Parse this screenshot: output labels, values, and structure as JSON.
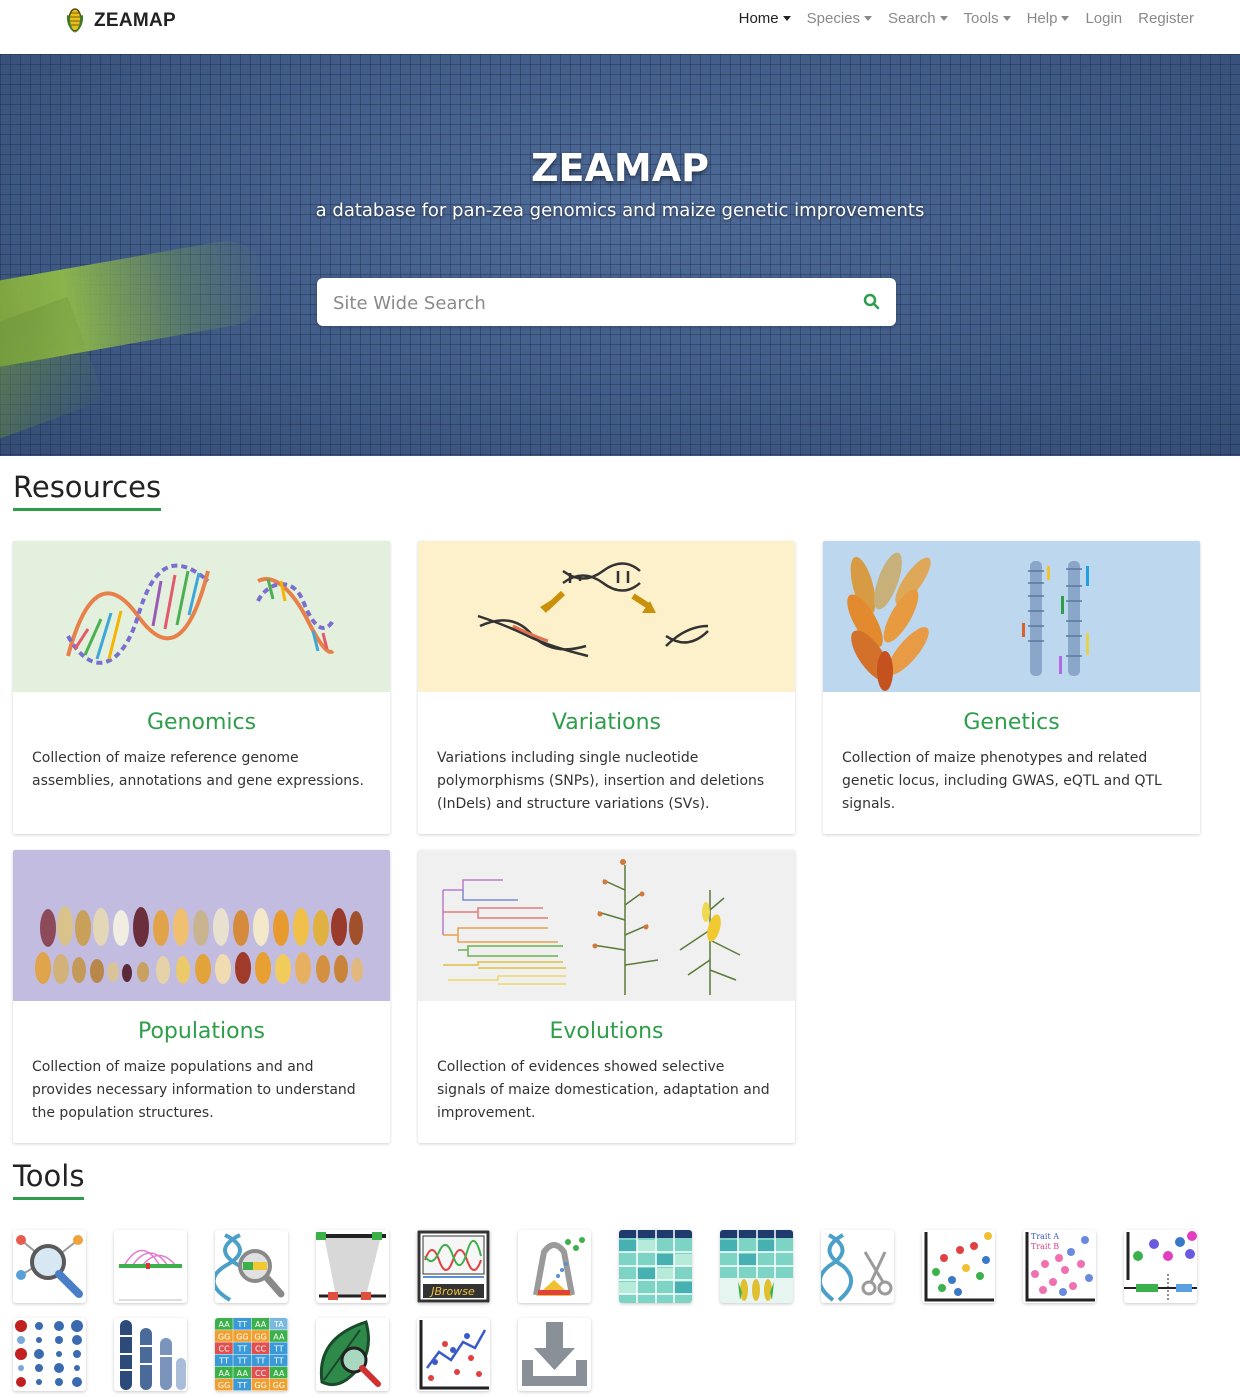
{
  "brand": {
    "name": "ZEAMAP"
  },
  "nav": {
    "items": [
      {
        "label": "Home",
        "dropdown": true,
        "active": true
      },
      {
        "label": "Species",
        "dropdown": true
      },
      {
        "label": "Search",
        "dropdown": true
      },
      {
        "label": "Tools",
        "dropdown": true
      },
      {
        "label": "Help",
        "dropdown": true
      },
      {
        "label": "Login",
        "dropdown": false
      },
      {
        "label": "Register",
        "dropdown": false
      }
    ]
  },
  "hero": {
    "title": "ZEAMAP",
    "subtitle": "a database for pan-zea genomics and maize genetic improvements",
    "search_placeholder": "Site Wide Search"
  },
  "resources": {
    "heading": "Resources",
    "cards": [
      {
        "title": "Genomics",
        "description": "Collection of maize reference genome assemblies, annotations and gene expressions.",
        "bg": "#e3f0dd"
      },
      {
        "title": "Variations",
        "description": "Variations including single nucleotide polymorphisms (SNPs), insertion and deletions (InDels) and structure variations (SVs).",
        "bg": "#fdf1cc"
      },
      {
        "title": "Genetics",
        "description": "Collection of maize phenotypes and related genetic locus, including GWAS, eQTL and QTL signals.",
        "bg": "#bcd7ee"
      },
      {
        "title": "Populations",
        "description": "Collection of maize populations and and provides necessary information to understand the population structures.",
        "bg": "#c2bde0"
      },
      {
        "title": "Evolutions",
        "description": "Collection of evidences showed selective signals of maize domestication, adaptation and improvement.",
        "bg": "#f0f0f0"
      }
    ]
  },
  "tools": {
    "heading": "Tools",
    "items": [
      {
        "icon": "network-search-icon"
      },
      {
        "icon": "synteny-arc-icon"
      },
      {
        "icon": "dna-search-icon"
      },
      {
        "icon": "genome-compare-icon"
      },
      {
        "icon": "jbrowse-icon",
        "text": "JBrowse"
      },
      {
        "icon": "primer-design-icon"
      },
      {
        "icon": "expression-heatmap-icon"
      },
      {
        "icon": "phenotype-heatmap-icon"
      },
      {
        "icon": "crispr-icon"
      },
      {
        "icon": "scatter-plot-icon"
      },
      {
        "icon": "trait-scatter-icon",
        "text_a": "Trait A",
        "text_b": "Trait B"
      },
      {
        "icon": "gene-structure-icon"
      },
      {
        "icon": "dot-matrix-icon"
      },
      {
        "icon": "chromosome-icon"
      },
      {
        "icon": "genotype-table-icon",
        "cells": [
          "AA",
          "TT",
          "AA",
          "TA",
          "GG",
          "GG",
          "GG",
          "AA",
          "CC",
          "TT",
          "CC",
          "TT",
          "TT",
          "TT",
          "TT",
          "TT",
          "AA",
          "AA",
          "CC",
          "AA",
          "GG",
          "TT",
          "GG",
          "GG"
        ]
      },
      {
        "icon": "leaf-search-icon"
      },
      {
        "icon": "line-chart-icon"
      },
      {
        "icon": "download-icon"
      }
    ]
  }
}
